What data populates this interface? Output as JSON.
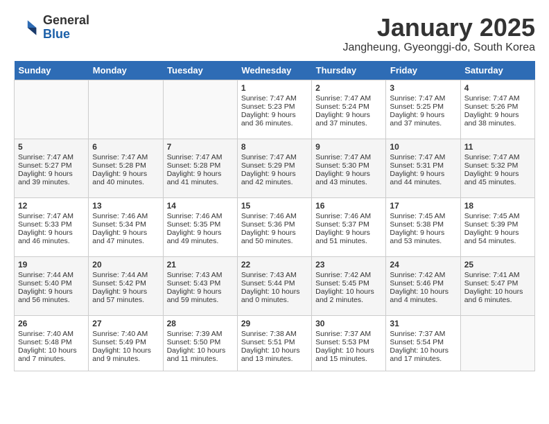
{
  "header": {
    "logo_general": "General",
    "logo_blue": "Blue",
    "month": "January 2025",
    "location": "Jangheung, Gyeonggi-do, South Korea"
  },
  "days_of_week": [
    "Sunday",
    "Monday",
    "Tuesday",
    "Wednesday",
    "Thursday",
    "Friday",
    "Saturday"
  ],
  "weeks": [
    [
      {
        "day": "",
        "content": ""
      },
      {
        "day": "",
        "content": ""
      },
      {
        "day": "",
        "content": ""
      },
      {
        "day": "1",
        "content": "Sunrise: 7:47 AM\nSunset: 5:23 PM\nDaylight: 9 hours and 36 minutes."
      },
      {
        "day": "2",
        "content": "Sunrise: 7:47 AM\nSunset: 5:24 PM\nDaylight: 9 hours and 37 minutes."
      },
      {
        "day": "3",
        "content": "Sunrise: 7:47 AM\nSunset: 5:25 PM\nDaylight: 9 hours and 37 minutes."
      },
      {
        "day": "4",
        "content": "Sunrise: 7:47 AM\nSunset: 5:26 PM\nDaylight: 9 hours and 38 minutes."
      }
    ],
    [
      {
        "day": "5",
        "content": "Sunrise: 7:47 AM\nSunset: 5:27 PM\nDaylight: 9 hours and 39 minutes."
      },
      {
        "day": "6",
        "content": "Sunrise: 7:47 AM\nSunset: 5:28 PM\nDaylight: 9 hours and 40 minutes."
      },
      {
        "day": "7",
        "content": "Sunrise: 7:47 AM\nSunset: 5:28 PM\nDaylight: 9 hours and 41 minutes."
      },
      {
        "day": "8",
        "content": "Sunrise: 7:47 AM\nSunset: 5:29 PM\nDaylight: 9 hours and 42 minutes."
      },
      {
        "day": "9",
        "content": "Sunrise: 7:47 AM\nSunset: 5:30 PM\nDaylight: 9 hours and 43 minutes."
      },
      {
        "day": "10",
        "content": "Sunrise: 7:47 AM\nSunset: 5:31 PM\nDaylight: 9 hours and 44 minutes."
      },
      {
        "day": "11",
        "content": "Sunrise: 7:47 AM\nSunset: 5:32 PM\nDaylight: 9 hours and 45 minutes."
      }
    ],
    [
      {
        "day": "12",
        "content": "Sunrise: 7:47 AM\nSunset: 5:33 PM\nDaylight: 9 hours and 46 minutes."
      },
      {
        "day": "13",
        "content": "Sunrise: 7:46 AM\nSunset: 5:34 PM\nDaylight: 9 hours and 47 minutes."
      },
      {
        "day": "14",
        "content": "Sunrise: 7:46 AM\nSunset: 5:35 PM\nDaylight: 9 hours and 49 minutes."
      },
      {
        "day": "15",
        "content": "Sunrise: 7:46 AM\nSunset: 5:36 PM\nDaylight: 9 hours and 50 minutes."
      },
      {
        "day": "16",
        "content": "Sunrise: 7:46 AM\nSunset: 5:37 PM\nDaylight: 9 hours and 51 minutes."
      },
      {
        "day": "17",
        "content": "Sunrise: 7:45 AM\nSunset: 5:38 PM\nDaylight: 9 hours and 53 minutes."
      },
      {
        "day": "18",
        "content": "Sunrise: 7:45 AM\nSunset: 5:39 PM\nDaylight: 9 hours and 54 minutes."
      }
    ],
    [
      {
        "day": "19",
        "content": "Sunrise: 7:44 AM\nSunset: 5:40 PM\nDaylight: 9 hours and 56 minutes."
      },
      {
        "day": "20",
        "content": "Sunrise: 7:44 AM\nSunset: 5:42 PM\nDaylight: 9 hours and 57 minutes."
      },
      {
        "day": "21",
        "content": "Sunrise: 7:43 AM\nSunset: 5:43 PM\nDaylight: 9 hours and 59 minutes."
      },
      {
        "day": "22",
        "content": "Sunrise: 7:43 AM\nSunset: 5:44 PM\nDaylight: 10 hours and 0 minutes."
      },
      {
        "day": "23",
        "content": "Sunrise: 7:42 AM\nSunset: 5:45 PM\nDaylight: 10 hours and 2 minutes."
      },
      {
        "day": "24",
        "content": "Sunrise: 7:42 AM\nSunset: 5:46 PM\nDaylight: 10 hours and 4 minutes."
      },
      {
        "day": "25",
        "content": "Sunrise: 7:41 AM\nSunset: 5:47 PM\nDaylight: 10 hours and 6 minutes."
      }
    ],
    [
      {
        "day": "26",
        "content": "Sunrise: 7:40 AM\nSunset: 5:48 PM\nDaylight: 10 hours and 7 minutes."
      },
      {
        "day": "27",
        "content": "Sunrise: 7:40 AM\nSunset: 5:49 PM\nDaylight: 10 hours and 9 minutes."
      },
      {
        "day": "28",
        "content": "Sunrise: 7:39 AM\nSunset: 5:50 PM\nDaylight: 10 hours and 11 minutes."
      },
      {
        "day": "29",
        "content": "Sunrise: 7:38 AM\nSunset: 5:51 PM\nDaylight: 10 hours and 13 minutes."
      },
      {
        "day": "30",
        "content": "Sunrise: 7:37 AM\nSunset: 5:53 PM\nDaylight: 10 hours and 15 minutes."
      },
      {
        "day": "31",
        "content": "Sunrise: 7:37 AM\nSunset: 5:54 PM\nDaylight: 10 hours and 17 minutes."
      },
      {
        "day": "",
        "content": ""
      }
    ]
  ]
}
